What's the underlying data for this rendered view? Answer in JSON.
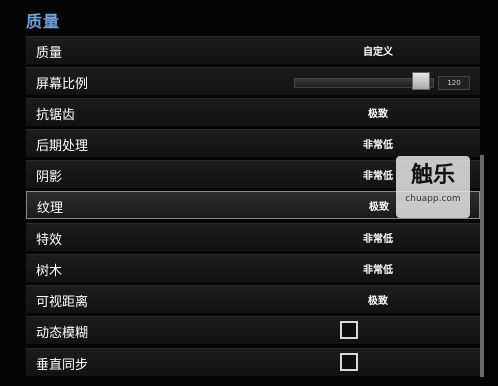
{
  "section_title": "质量",
  "rows": [
    {
      "label": "质量",
      "value": "自定义"
    },
    {
      "label": "屏幕比例",
      "value": "120"
    },
    {
      "label": "抗锯齿",
      "value": "极致"
    },
    {
      "label": "后期处理",
      "value": "非常低"
    },
    {
      "label": "阴影",
      "value": "非常低"
    },
    {
      "label": "纹理",
      "value": "极致"
    },
    {
      "label": "特效",
      "value": "非常低"
    },
    {
      "label": "树木",
      "value": "非常低"
    },
    {
      "label": "可视距离",
      "value": "极致"
    },
    {
      "label": "动态模糊",
      "value": ""
    },
    {
      "label": "垂直同步",
      "value": ""
    }
  ],
  "screen_ratio_slider_fraction": 0.9,
  "watermark": {
    "logo": "触乐",
    "url": "chuapp.com"
  }
}
